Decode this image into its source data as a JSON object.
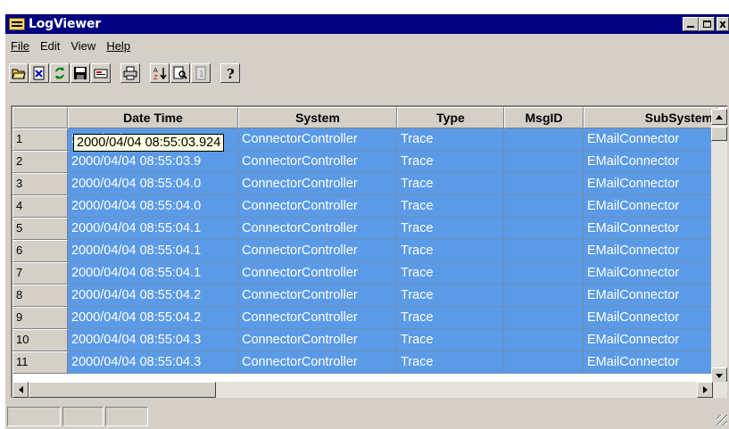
{
  "window": {
    "title": "LogViewer",
    "buttons": {
      "minimize": "_",
      "maximize": "□",
      "close": "x"
    }
  },
  "menu": [
    {
      "label": "File"
    },
    {
      "label": "Edit"
    },
    {
      "label": "View"
    },
    {
      "label": "Help"
    }
  ],
  "toolbar": {
    "icons": [
      "open-folder-icon",
      "clear-log-icon",
      "refresh-icon",
      "save-icon",
      "filter-icon",
      "print-icon",
      "sort-az-icon",
      "find-icon",
      "properties-icon",
      "help-icon"
    ]
  },
  "grid": {
    "columns": [
      "Date Time",
      "System",
      "Type",
      "MsgID",
      "SubSystem"
    ],
    "rows": [
      {
        "n": "1",
        "datetime": "2000/04/04 08:55:03.924",
        "system": "ConnectorController",
        "type": "Trace",
        "msgid": "",
        "subsystem": "EMailConnector"
      },
      {
        "n": "2",
        "datetime": "2000/04/04 08:55:03.9",
        "system": "ConnectorController",
        "type": "Trace",
        "msgid": "",
        "subsystem": "EMailConnector"
      },
      {
        "n": "3",
        "datetime": "2000/04/04 08:55:04.0",
        "system": "ConnectorController",
        "type": "Trace",
        "msgid": "",
        "subsystem": "EMailConnector"
      },
      {
        "n": "4",
        "datetime": "2000/04/04 08:55:04.0",
        "system": "ConnectorController",
        "type": "Trace",
        "msgid": "",
        "subsystem": "EMailConnector"
      },
      {
        "n": "5",
        "datetime": "2000/04/04 08:55:04.1",
        "system": "ConnectorController",
        "type": "Trace",
        "msgid": "",
        "subsystem": "EMailConnector"
      },
      {
        "n": "6",
        "datetime": "2000/04/04 08:55:04.1",
        "system": "ConnectorController",
        "type": "Trace",
        "msgid": "",
        "subsystem": "EMailConnector"
      },
      {
        "n": "7",
        "datetime": "2000/04/04 08:55:04.1",
        "system": "ConnectorController",
        "type": "Trace",
        "msgid": "",
        "subsystem": "EMailConnector"
      },
      {
        "n": "8",
        "datetime": "2000/04/04 08:55:04.2",
        "system": "ConnectorController",
        "type": "Trace",
        "msgid": "",
        "subsystem": "EMailConnector"
      },
      {
        "n": "9",
        "datetime": "2000/04/04 08:55:04.2",
        "system": "ConnectorController",
        "type": "Trace",
        "msgid": "",
        "subsystem": "EMailConnector"
      },
      {
        "n": "10",
        "datetime": "2000/04/04 08:55:04.3",
        "system": "ConnectorController",
        "type": "Trace",
        "msgid": "",
        "subsystem": "EMailConnector"
      },
      {
        "n": "11",
        "datetime": "2000/04/04 08:55:04.3",
        "system": "ConnectorController",
        "type": "Trace",
        "msgid": "",
        "subsystem": "EMailConnector"
      }
    ],
    "tooltip": "2000/04/04 08:55:03.924",
    "selection_color": "#5b9ae6"
  },
  "colors": {
    "titlebar": "#000080",
    "chrome": "#d4d0c8"
  }
}
